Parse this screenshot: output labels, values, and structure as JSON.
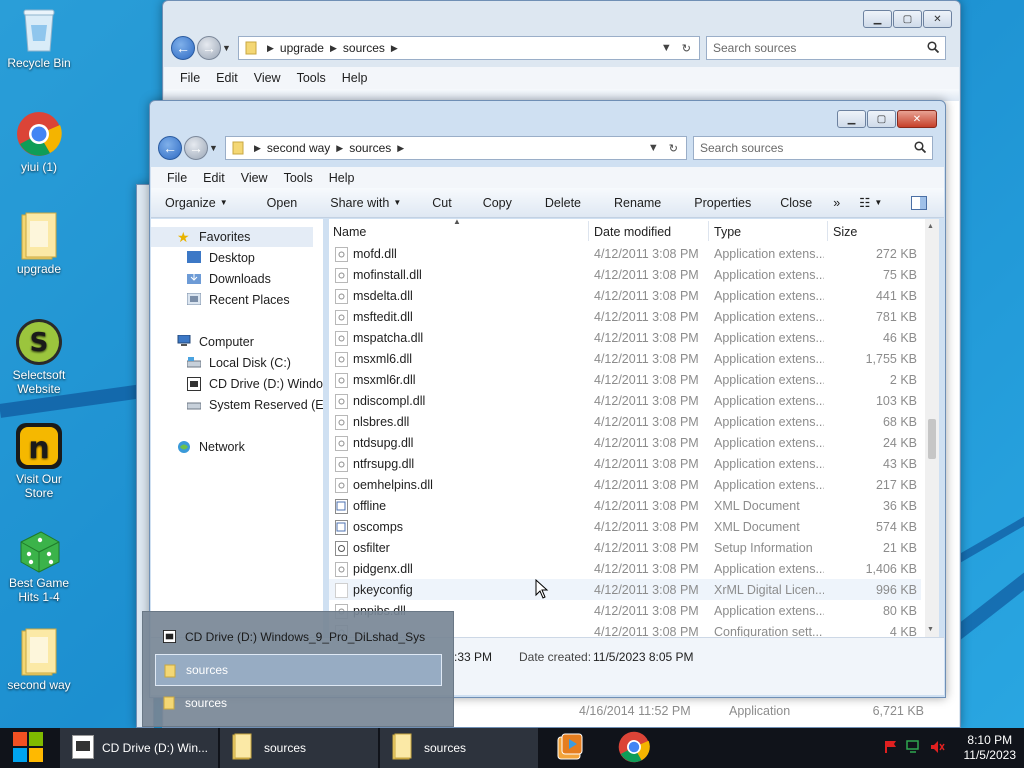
{
  "desktop": {
    "icons": [
      {
        "label": "Recycle Bin",
        "icon": "recycle-bin-icon"
      },
      {
        "label": "yiui (1)",
        "icon": "chrome-icon"
      },
      {
        "label": "upgrade",
        "icon": "folder-icon"
      },
      {
        "label": "Selectsoft Website",
        "icon": "selectsoft-icon"
      },
      {
        "label": "Visit Our Store",
        "icon": "store-icon"
      },
      {
        "label": "Best Game Hits 1-4",
        "icon": "dice-icon"
      },
      {
        "label": "second way",
        "icon": "folder-icon"
      }
    ]
  },
  "back_window": {
    "breadcrumb": [
      "upgrade",
      "sources"
    ],
    "search_placeholder": "Search sources",
    "menu": [
      "File",
      "Edit",
      "View",
      "Tools",
      "Help"
    ],
    "status_date": "4/16/2014 11:52 PM",
    "status_type": "Application",
    "status_size": "6,721 KB"
  },
  "front_window": {
    "breadcrumb": [
      "second way",
      "sources"
    ],
    "search_placeholder": "Search sources",
    "menu": [
      "File",
      "Edit",
      "View",
      "Tools",
      "Help"
    ],
    "commands": {
      "organize": "Organize",
      "open": "Open",
      "share_with": "Share with",
      "cut": "Cut",
      "copy": "Copy",
      "delete": "Delete",
      "rename": "Rename",
      "properties": "Properties",
      "close": "Close",
      "more": "»"
    },
    "nav": {
      "favorites": "Favorites",
      "desktop": "Desktop",
      "downloads": "Downloads",
      "recent": "Recent Places",
      "computer": "Computer",
      "local_disk": "Local Disk (C:)",
      "cd_drive": "CD Drive (D:) Windo",
      "system_reserved": "System Reserved (E:)",
      "network": "Network"
    },
    "columns": {
      "name": "Name",
      "date": "Date modified",
      "type": "Type",
      "size": "Size"
    },
    "files": [
      {
        "name": "mofd.dll",
        "date": "4/12/2011 3:08 PM",
        "type": "Application extens...",
        "size": "272 KB",
        "kind": "dll"
      },
      {
        "name": "mofinstall.dll",
        "date": "4/12/2011 3:08 PM",
        "type": "Application extens...",
        "size": "75 KB",
        "kind": "dll"
      },
      {
        "name": "msdelta.dll",
        "date": "4/12/2011 3:08 PM",
        "type": "Application extens...",
        "size": "441 KB",
        "kind": "dll"
      },
      {
        "name": "msftedit.dll",
        "date": "4/12/2011 3:08 PM",
        "type": "Application extens...",
        "size": "781 KB",
        "kind": "dll"
      },
      {
        "name": "mspatcha.dll",
        "date": "4/12/2011 3:08 PM",
        "type": "Application extens...",
        "size": "46 KB",
        "kind": "dll"
      },
      {
        "name": "msxml6.dll",
        "date": "4/12/2011 3:08 PM",
        "type": "Application extens...",
        "size": "1,755 KB",
        "kind": "dll"
      },
      {
        "name": "msxml6r.dll",
        "date": "4/12/2011 3:08 PM",
        "type": "Application extens...",
        "size": "2 KB",
        "kind": "dll"
      },
      {
        "name": "ndiscompl.dll",
        "date": "4/12/2011 3:08 PM",
        "type": "Application extens...",
        "size": "103 KB",
        "kind": "dll"
      },
      {
        "name": "nlsbres.dll",
        "date": "4/12/2011 3:08 PM",
        "type": "Application extens...",
        "size": "68 KB",
        "kind": "dll"
      },
      {
        "name": "ntdsupg.dll",
        "date": "4/12/2011 3:08 PM",
        "type": "Application extens...",
        "size": "24 KB",
        "kind": "dll"
      },
      {
        "name": "ntfrsupg.dll",
        "date": "4/12/2011 3:08 PM",
        "type": "Application extens...",
        "size": "43 KB",
        "kind": "dll"
      },
      {
        "name": "oemhelpins.dll",
        "date": "4/12/2011 3:08 PM",
        "type": "Application extens...",
        "size": "217 KB",
        "kind": "dll"
      },
      {
        "name": "offline",
        "date": "4/12/2011 3:08 PM",
        "type": "XML Document",
        "size": "36 KB",
        "kind": "xml"
      },
      {
        "name": "oscomps",
        "date": "4/12/2011 3:08 PM",
        "type": "XML Document",
        "size": "574 KB",
        "kind": "xml"
      },
      {
        "name": "osfilter",
        "date": "4/12/2011 3:08 PM",
        "type": "Setup Information",
        "size": "21 KB",
        "kind": "inf"
      },
      {
        "name": "pidgenx.dll",
        "date": "4/12/2011 3:08 PM",
        "type": "Application extens...",
        "size": "1,406 KB",
        "kind": "dll"
      },
      {
        "name": "pkeyconfig",
        "date": "4/12/2011 3:08 PM",
        "type": "XrML Digital Licen...",
        "size": "996 KB",
        "kind": "blank"
      },
      {
        "name": "pnpibs.dll",
        "date": "4/12/2011 3:08 PM",
        "type": "Application extens...",
        "size": "80 KB",
        "kind": "dll"
      },
      {
        "name": "",
        "date": "4/12/2011 3:08 PM",
        "type": "Configuration sett...",
        "size": "4 KB",
        "kind": "dll"
      }
    ],
    "status": {
      "modified_tail": ":33 PM",
      "created_label": "Date created:",
      "created_value": "11/5/2023 8:05 PM"
    }
  },
  "jump_popup": {
    "items": [
      {
        "label": "CD Drive (D:) Windows_9_Pro_DiLshad_Sys",
        "icon": "cd-drive-icon"
      },
      {
        "label": "sources",
        "icon": "folder-icon"
      },
      {
        "label": "sources",
        "icon": "folder-icon"
      }
    ]
  },
  "taskbar": {
    "buttons": [
      {
        "label": "CD Drive (D:) Win...",
        "icon": "cd-drive-icon"
      },
      {
        "label": "sources",
        "icon": "folder-icon"
      },
      {
        "label": "sources",
        "icon": "folder-icon"
      }
    ],
    "clock_time": "8:10 PM",
    "clock_date": "11/5/2023"
  }
}
